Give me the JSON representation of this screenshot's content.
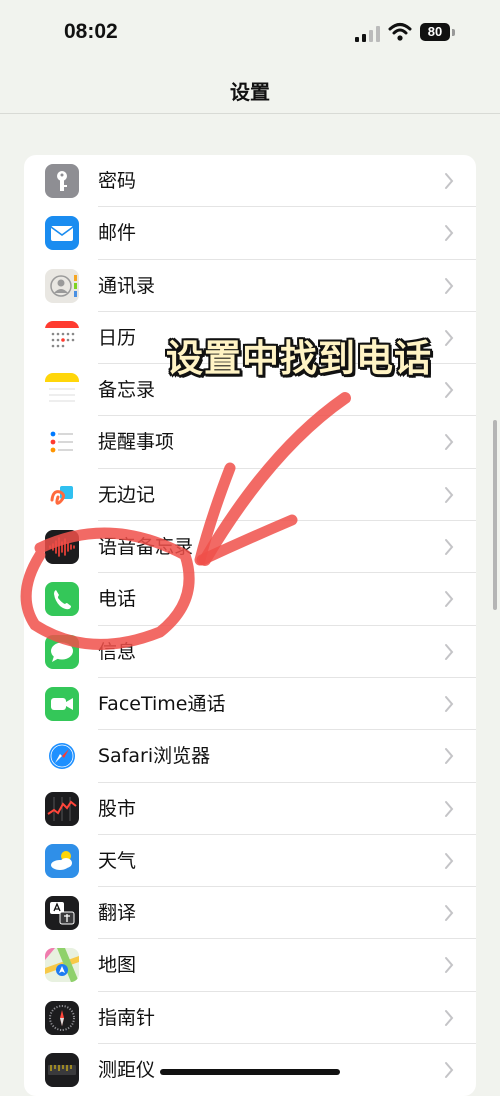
{
  "status_bar": {
    "time": "08:02",
    "battery_level": "80"
  },
  "nav": {
    "title": "设置"
  },
  "settings": {
    "items": [
      {
        "label": "密码",
        "icon": "key-icon"
      },
      {
        "label": "邮件",
        "icon": "mail-icon"
      },
      {
        "label": "通讯录",
        "icon": "contacts-icon"
      },
      {
        "label": "日历",
        "icon": "calendar-icon"
      },
      {
        "label": "备忘录",
        "icon": "notes-icon"
      },
      {
        "label": "提醒事项",
        "icon": "reminders-icon"
      },
      {
        "label": "无边记",
        "icon": "freeform-icon"
      },
      {
        "label": "语音备忘录",
        "icon": "voice-memos-icon"
      },
      {
        "label": "电话",
        "icon": "phone-icon"
      },
      {
        "label": "信息",
        "icon": "messages-icon"
      },
      {
        "label": "FaceTime通话",
        "icon": "facetime-icon"
      },
      {
        "label": "Safari浏览器",
        "icon": "safari-icon"
      },
      {
        "label": "股市",
        "icon": "stocks-icon"
      },
      {
        "label": "天气",
        "icon": "weather-icon"
      },
      {
        "label": "翻译",
        "icon": "translate-icon"
      },
      {
        "label": "地图",
        "icon": "maps-icon"
      },
      {
        "label": "指南针",
        "icon": "compass-icon"
      },
      {
        "label": "测距仪",
        "icon": "measure-icon"
      }
    ]
  },
  "annotation": {
    "text": "设置中找到电话",
    "color": "#f0504a"
  }
}
